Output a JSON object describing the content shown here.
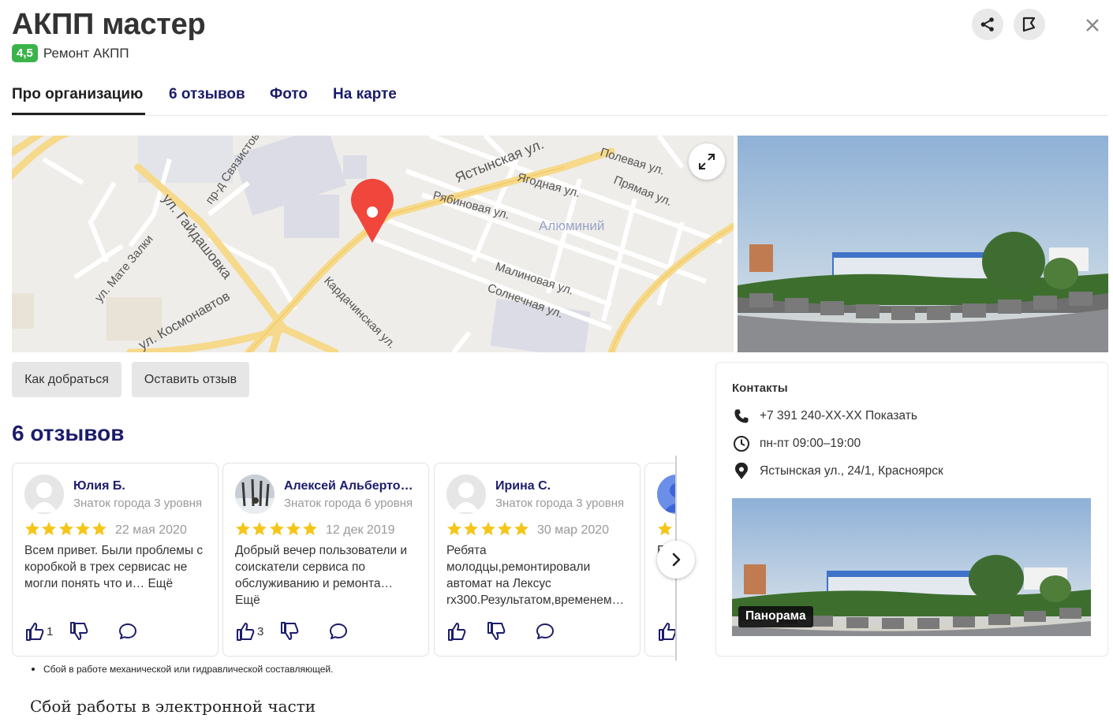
{
  "header": {
    "title": "АКПП мастер",
    "rating": "4,5",
    "category": "Ремонт АКПП",
    "share_icon": "share-icon",
    "bookmark_icon": "bookmark-icon",
    "close_icon": "close-icon"
  },
  "tabs": [
    {
      "label": "Про организацию",
      "active": true
    },
    {
      "label": "6 отзывов",
      "active": false
    },
    {
      "label": "Фото",
      "active": false
    },
    {
      "label": "На карте",
      "active": false
    }
  ],
  "map": {
    "labels": {
      "yastynskaya": "Ястынская ул.",
      "polevaya": "Полевая ул.",
      "pryamaya": "Прямая ул.",
      "yagodnaya": "Ягодная ул.",
      "ryabinovaya": "Рябиновая ул.",
      "aluminiy": "Алюминий",
      "malinovaya": "Малиновая ул.",
      "solnechnaya": "Солнечная ул.",
      "kardachinskaya": "Кардачинская ул.",
      "gaydashovka": "ул. Гайдашовка",
      "svyazistov": "пр-д Связистов",
      "mate_zalki": "ул. Мате Залки",
      "kosmonavtov": "ул. Космонавтов"
    },
    "pin_color": "#f0463c"
  },
  "actions": {
    "route": "Как добраться",
    "review": "Оставить отзыв"
  },
  "reviews": {
    "title": "6 отзывов",
    "items": [
      {
        "author": "Юлия Б.",
        "level": "Знаток города 3 уровня",
        "stars": 5,
        "date": "22 мая 2020",
        "text": "Всем привет. Были проблемы с коробкой в трех сервисас не могли понять что и…",
        "more": "Ещё",
        "likes": "1",
        "dislikes": ""
      },
      {
        "author": "Алексей Альбертович",
        "level": "Знаток города 6 уровня",
        "stars": 5,
        "date": "12 дек 2019",
        "text": "Добрый вечер пользователи и соискатели сервиса по обслуживанию и ремонта…",
        "more": "Ещё",
        "likes": "3",
        "dislikes": ""
      },
      {
        "author": "Ирина С.",
        "level": "Знаток города 3 уровня",
        "stars": 5,
        "date": "30 мар 2020",
        "text": "Ребята молодцы,ремонтировали автомат на Лексус rx300.Результатом,временем…",
        "more": "",
        "likes": "",
        "dislikes": ""
      },
      {
        "author": "",
        "level": "",
        "stars": 5,
        "date": "",
        "text": "Б… А… рас… нав…",
        "more": "",
        "likes": "",
        "dislikes": ""
      }
    ],
    "next_icon": "chevron-right-icon"
  },
  "contacts": {
    "title": "Контакты",
    "phone": "+7 391 240-ХХ-ХХ",
    "phone_show": "Показать",
    "hours": "пн-пт 09:00–19:00",
    "address": "Ястынская ул., 24/1, Красноярск",
    "panorama_label": "Панорама"
  },
  "below": {
    "bullet": "Сбой в работе механической или гидравлической составляющей.",
    "heading": "Сбой работы в электронной части"
  },
  "colors": {
    "rating_badge": "#3bb34a",
    "link": "#1c1c6b",
    "star": "#f5c518"
  }
}
